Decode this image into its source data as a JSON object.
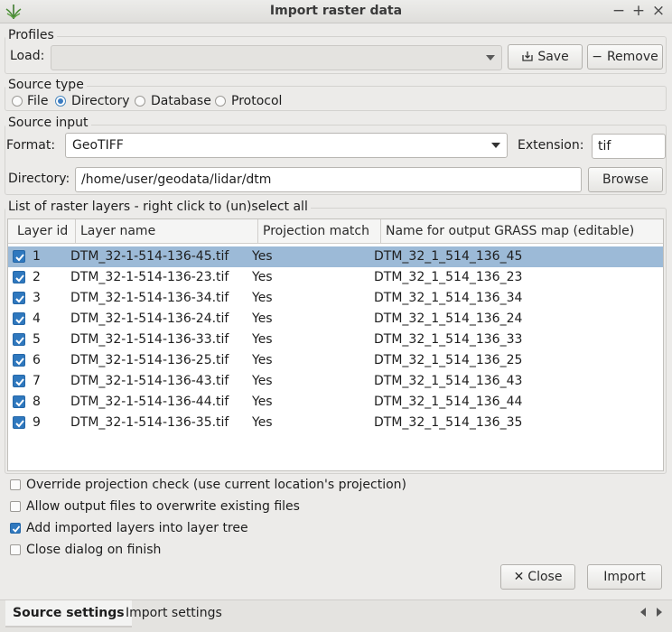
{
  "window": {
    "title": "Import raster data",
    "controls": {
      "minimize": "−",
      "maximize": "+",
      "close": "×"
    }
  },
  "profiles": {
    "group_title": "Profiles",
    "load_label": "Load:",
    "load_value": "",
    "save_label": "Save",
    "remove_label": "Remove"
  },
  "source_type": {
    "group_title": "Source type",
    "options": [
      "File",
      "Directory",
      "Database",
      "Protocol"
    ],
    "selected": "Directory"
  },
  "source_input": {
    "group_title": "Source input",
    "format_label": "Format:",
    "format_value": "GeoTIFF",
    "extension_label": "Extension:",
    "extension_value": "tif",
    "directory_label": "Directory:",
    "directory_value": "/home/user/geodata/lidar/dtm",
    "browse_label": "Browse"
  },
  "layers": {
    "group_title": "List of raster layers - right click to (un)select all",
    "columns": [
      "Layer id",
      "Layer name",
      "Projection match",
      "Name for output GRASS map (editable)"
    ],
    "rows": [
      {
        "id": "1",
        "name": "DTM_32-1-514-136-45.tif",
        "match": "Yes",
        "output": "DTM_32_1_514_136_45",
        "checked": true,
        "selected": true
      },
      {
        "id": "2",
        "name": "DTM_32-1-514-136-23.tif",
        "match": "Yes",
        "output": "DTM_32_1_514_136_23",
        "checked": true,
        "selected": false
      },
      {
        "id": "3",
        "name": "DTM_32-1-514-136-34.tif",
        "match": "Yes",
        "output": "DTM_32_1_514_136_34",
        "checked": true,
        "selected": false
      },
      {
        "id": "4",
        "name": "DTM_32-1-514-136-24.tif",
        "match": "Yes",
        "output": "DTM_32_1_514_136_24",
        "checked": true,
        "selected": false
      },
      {
        "id": "5",
        "name": "DTM_32-1-514-136-33.tif",
        "match": "Yes",
        "output": "DTM_32_1_514_136_33",
        "checked": true,
        "selected": false
      },
      {
        "id": "6",
        "name": "DTM_32-1-514-136-25.tif",
        "match": "Yes",
        "output": "DTM_32_1_514_136_25",
        "checked": true,
        "selected": false
      },
      {
        "id": "7",
        "name": "DTM_32-1-514-136-43.tif",
        "match": "Yes",
        "output": "DTM_32_1_514_136_43",
        "checked": true,
        "selected": false
      },
      {
        "id": "8",
        "name": "DTM_32-1-514-136-44.tif",
        "match": "Yes",
        "output": "DTM_32_1_514_136_44",
        "checked": true,
        "selected": false
      },
      {
        "id": "9",
        "name": "DTM_32-1-514-136-35.tif",
        "match": "Yes",
        "output": "DTM_32_1_514_136_35",
        "checked": true,
        "selected": false
      }
    ]
  },
  "options": [
    {
      "label": "Override projection check (use current location's projection)",
      "checked": false
    },
    {
      "label": "Allow output files to overwrite existing files",
      "checked": false
    },
    {
      "label": "Add imported layers into layer tree",
      "checked": true
    },
    {
      "label": "Close dialog on finish",
      "checked": false
    }
  ],
  "actions": {
    "close_label": "Close",
    "import_label": "Import"
  },
  "tabs": [
    "Source settings",
    "Import settings"
  ],
  "active_tab": "Source settings",
  "colors": {
    "selection": "#9cbad7",
    "accent": "#2f78be",
    "background": "#ecebe9"
  }
}
